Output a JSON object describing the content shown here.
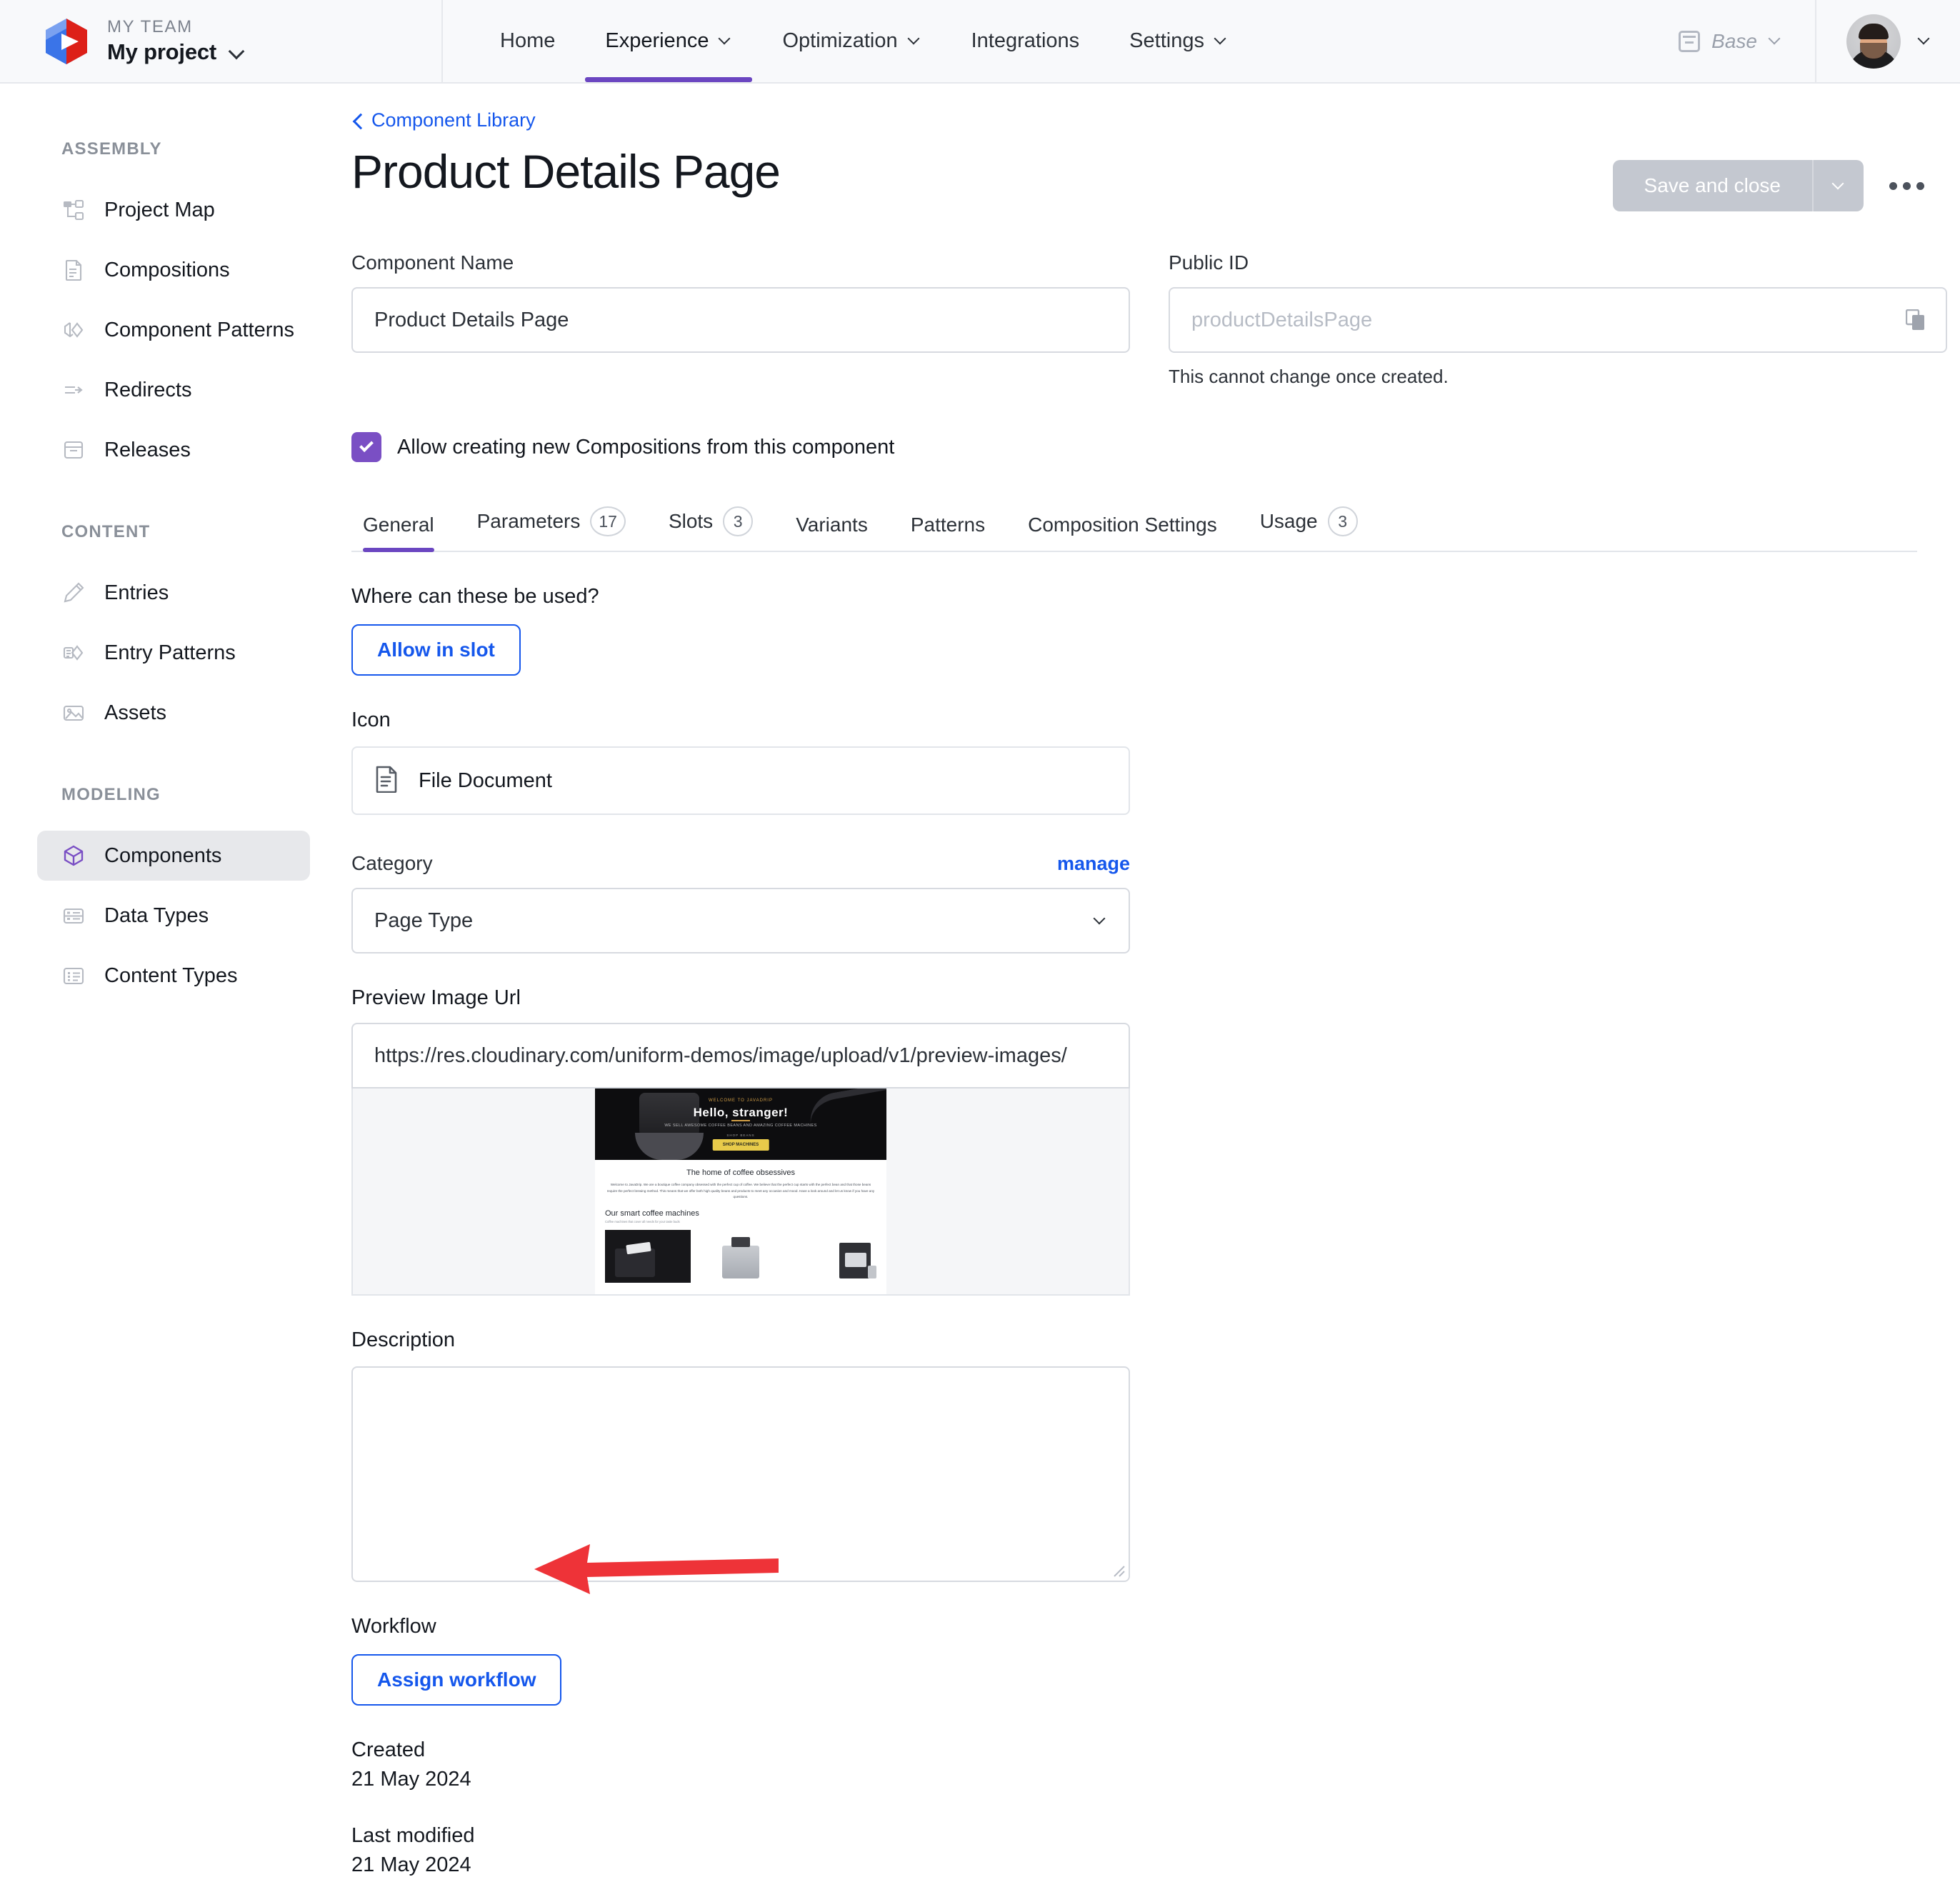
{
  "topbar": {
    "team_label": "MY TEAM",
    "project_name": "My project",
    "logo_icon": "uniform-hexagon-logo",
    "project_chevron_icon": "chevron-down-icon",
    "nav": [
      {
        "label": "Home",
        "has_caret": false,
        "active": false
      },
      {
        "label": "Experience",
        "has_caret": true,
        "active": true
      },
      {
        "label": "Optimization",
        "has_caret": true,
        "active": false
      },
      {
        "label": "Integrations",
        "has_caret": false,
        "active": false
      },
      {
        "label": "Settings",
        "has_caret": true,
        "active": false
      }
    ],
    "base_selector": {
      "label": "Base",
      "icon": "release-calendar-icon",
      "caret_icon": "chevron-down-icon"
    },
    "avatar": {
      "icon": "user-avatar",
      "caret_icon": "chevron-down-icon"
    }
  },
  "sidebar": {
    "groups": [
      {
        "label": "ASSEMBLY",
        "items": [
          {
            "label": "Project Map",
            "icon": "sitemap-icon",
            "active": false
          },
          {
            "label": "Compositions",
            "icon": "document-lines-icon",
            "active": false
          },
          {
            "label": "Component Patterns",
            "icon": "cube-diamond-icon",
            "active": false
          },
          {
            "label": "Redirects",
            "icon": "arrow-right-lines-icon",
            "active": false
          },
          {
            "label": "Releases",
            "icon": "release-calendar-icon",
            "active": false
          }
        ]
      },
      {
        "label": "CONTENT",
        "items": [
          {
            "label": "Entries",
            "icon": "pencil-icon",
            "active": false
          },
          {
            "label": "Entry Patterns",
            "icon": "tag-diamond-icon",
            "active": false
          },
          {
            "label": "Assets",
            "icon": "image-icon",
            "active": false
          }
        ]
      },
      {
        "label": "MODELING",
        "items": [
          {
            "label": "Components",
            "icon": "cube-icon",
            "active": true
          },
          {
            "label": "Data Types",
            "icon": "data-list-icon",
            "active": false
          },
          {
            "label": "Content Types",
            "icon": "content-list-icon",
            "active": false
          }
        ]
      }
    ]
  },
  "main": {
    "breadcrumb": {
      "label": "Component Library",
      "icon": "chevron-left-icon"
    },
    "page_title": "Product Details Page",
    "actions": {
      "save_label": "Save and close",
      "save_caret_icon": "chevron-down-icon",
      "more_icon": "more-horizontal-icon"
    },
    "component_name": {
      "label": "Component Name",
      "value": "Product Details Page",
      "placeholder": "Component Name"
    },
    "public_id": {
      "label": "Public ID",
      "value": "",
      "placeholder": "productDetailsPage",
      "hint": "This cannot change once created.",
      "copy_icon": "copy-icon"
    },
    "allow_compositions": {
      "label": "Allow creating new Compositions from this component",
      "checked": true,
      "check_icon": "checkmark-icon",
      "accent_color": "#7a4fc4"
    },
    "tabs": [
      {
        "label": "General",
        "badge": "",
        "active": true
      },
      {
        "label": "Parameters",
        "badge": "17",
        "active": false
      },
      {
        "label": "Slots",
        "badge": "3",
        "active": false
      },
      {
        "label": "Variants",
        "badge": "",
        "active": false
      },
      {
        "label": "Patterns",
        "badge": "",
        "active": false
      },
      {
        "label": "Composition Settings",
        "badge": "",
        "active": false
      },
      {
        "label": "Usage",
        "badge": "3",
        "active": false
      }
    ],
    "where_used": {
      "label": "Where can these be used?",
      "button_label": "Allow in slot"
    },
    "icon_field": {
      "label": "Icon",
      "value": "File Document",
      "icon": "file-document-icon"
    },
    "category": {
      "label": "Category",
      "manage_label": "manage",
      "value": "Page Type",
      "caret_icon": "chevron-down-icon"
    },
    "preview_image": {
      "label": "Preview Image Url",
      "value": "https://res.cloudinary.com/uniform-demos/image/upload/v1/preview-images/",
      "placeholder": "Preview Image Url",
      "thumbnail": {
        "hero_eyebrow": "WELCOME TO JAVADRIP",
        "hero_title": "Hello, stranger!",
        "hero_subtitle": "WE SELL AWESOME COFFEE BEANS AND AMAZING COFFEE MACHINES",
        "hero_small": "SHOP BEANS",
        "hero_button": "SHOP MACHINES",
        "section_title": "The home of coffee obsessives",
        "section_paragraph": "Welcome to JavaDrip. We are a boutique coffee company obsessed with the perfect cup of coffee. We believe that the perfect cup starts with the perfect bean and that those beans require the perfect brewing method. This means that we offer both high quality beans and products to meet any occasion and mood. Have a look around and let us know if you have any questions.",
        "products_title": "Our smart coffee machines",
        "products_subtitle": "Coffee machines that cover all needs for your taste buds"
      }
    },
    "description": {
      "label": "Description",
      "value": "",
      "placeholder": ""
    },
    "workflow": {
      "label": "Workflow",
      "button_label": "Assign workflow"
    },
    "created": {
      "label": "Created",
      "value": "21 May 2024"
    },
    "last_modified": {
      "label": "Last modified",
      "value": "21 May 2024"
    }
  },
  "annotation": {
    "arrow_icon": "red-arrow-pointing-left",
    "color": "#ee3338"
  }
}
